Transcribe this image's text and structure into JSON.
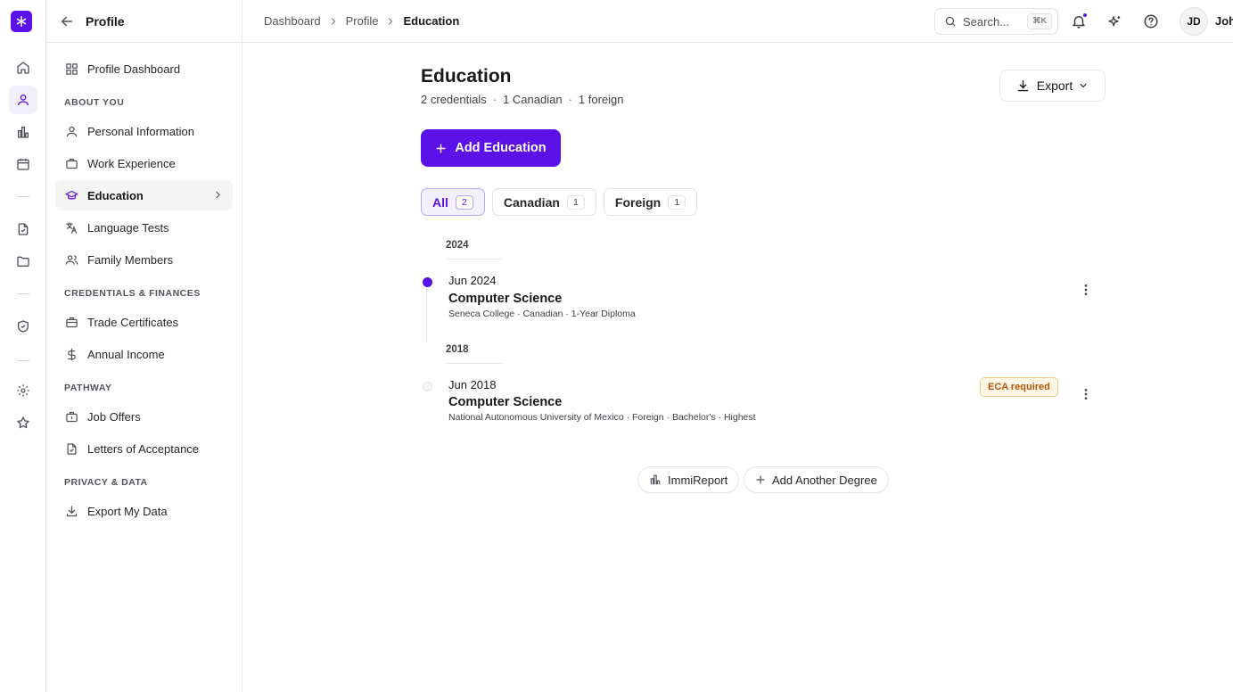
{
  "app": {
    "accent": "#5b12e9"
  },
  "rail": {
    "items": [
      "asterisk-logo",
      "home-icon",
      "user-icon",
      "chart-icon",
      "calendar-icon",
      "file-check-icon",
      "folder-icon",
      "shield-check-icon",
      "settings-icon",
      "star-icon"
    ]
  },
  "sidebar": {
    "title": "Profile",
    "dashboard": "Profile Dashboard",
    "sections": [
      {
        "label": "ABOUT YOU",
        "items": [
          "Personal Information",
          "Work Experience",
          "Education",
          "Language Tests",
          "Family Members"
        ]
      },
      {
        "label": "CREDENTIALS & FINANCES",
        "items": [
          "Trade Certificates",
          "Annual Income"
        ]
      },
      {
        "label": "PATHWAY",
        "items": [
          "Job Offers",
          "Letters of Acceptance"
        ]
      },
      {
        "label": "PRIVACY & DATA",
        "items": [
          "Export My Data"
        ]
      }
    ],
    "active": "Education"
  },
  "topbar": {
    "breadcrumbs": [
      "Dashboard",
      "Profile",
      "Education"
    ],
    "search_label": "Search...",
    "search_shortcut": "⌘K",
    "avatar_initials": "JD",
    "user_name": "John"
  },
  "main": {
    "title": "Education",
    "summary": [
      "2 credentials",
      "1 Canadian",
      "1 foreign"
    ],
    "summary_sep": "·",
    "export_label": "Export",
    "add_label": "Add Education",
    "tabs": [
      {
        "label": "All",
        "count": "2",
        "active": true
      },
      {
        "label": "Canadian",
        "count": "1",
        "active": false
      },
      {
        "label": "Foreign",
        "count": "1",
        "active": false
      }
    ],
    "groups": [
      {
        "year": "2024",
        "entry": {
          "date": "Jun 2024",
          "title": "Computer Science",
          "meta": "Seneca College · Canadian · 1-Year Diploma",
          "badge": ""
        }
      },
      {
        "year": "2018",
        "entry": {
          "date": "Jun 2018",
          "title": "Computer Science",
          "meta": "National Autonomous University of Mexico · Foreign · Bachelor's · Highest",
          "badge": "ECA required"
        }
      }
    ],
    "footer": {
      "report_label": "ImmiReport",
      "add_degree_label": "Add Another Degree"
    }
  }
}
